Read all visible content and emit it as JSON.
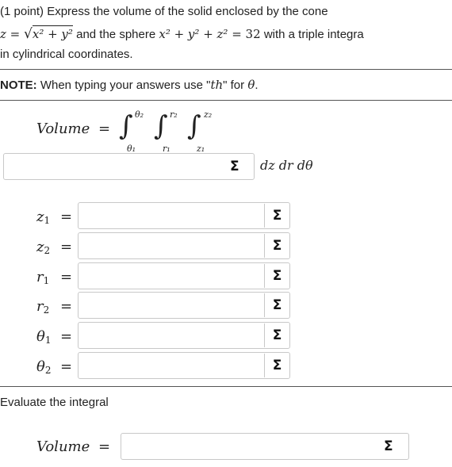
{
  "problem": {
    "line1": "(1 point) Express the volume of the solid enclosed by the cone",
    "line2_z": "z",
    "line2_eq": " = ",
    "line2_sqrt": "x² + y²",
    "line2_mid": " and the sphere ",
    "line2_sphere": "x² + y² + z²",
    "line2_eq2": " = 32",
    "line2_tail": " with a triple integra",
    "line3": "in cylindrical coordinates."
  },
  "note": {
    "label": "NOTE:",
    "text": " When typing your answers use \"",
    "th": "th",
    "text2": "\" for ",
    "theta": "θ",
    "end": "."
  },
  "volume_expr": {
    "label": "Volume",
    "eq": "=",
    "int_symbol": "∫",
    "lim_theta_upper": "θ₂",
    "lim_theta_lower": "θ₁",
    "lim_r_upper": "r₂",
    "lim_r_lower": "r₁",
    "lim_z_upper": "z₂",
    "lim_z_lower": "z₁",
    "differentials": "dz dr dθ"
  },
  "fields": [
    {
      "var": "z",
      "sub": "1",
      "eq": "=",
      "value": ""
    },
    {
      "var": "z",
      "sub": "2",
      "eq": "=",
      "value": ""
    },
    {
      "var": "r",
      "sub": "1",
      "eq": "=",
      "value": ""
    },
    {
      "var": "r",
      "sub": "2",
      "eq": "=",
      "value": ""
    },
    {
      "var": "θ",
      "sub": "1",
      "eq": "=",
      "value": ""
    },
    {
      "var": "θ",
      "sub": "2",
      "eq": "=",
      "value": ""
    }
  ],
  "integrand_field": {
    "value": ""
  },
  "evaluate": {
    "text": "Evaluate the integral",
    "label": "Volume",
    "eq": "=",
    "value": ""
  },
  "icons": {
    "sigma": "Σ"
  }
}
